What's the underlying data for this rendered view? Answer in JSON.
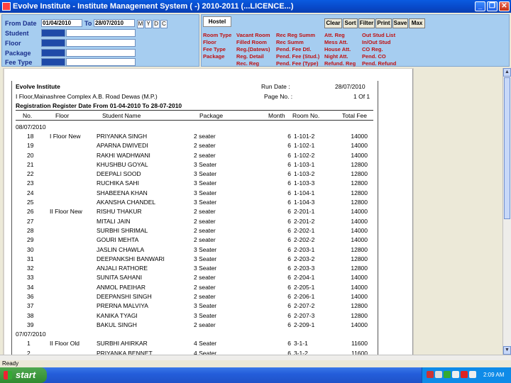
{
  "window": {
    "title": "Evolve Institute - Institute Management System ( -) 2010-2011 (...LICENCE...)",
    "minimize_icon": "minimize-icon",
    "restore_icon": "restore-icon",
    "close_icon": "close-icon"
  },
  "filters": {
    "from_label": "From Date",
    "from_value": "01/04/2010",
    "to_label": "To",
    "to_value": "28/07/2010",
    "period_buttons": [
      "M",
      "Y",
      "D",
      "C"
    ],
    "student_label": "Student",
    "floor_label": "Floor",
    "package_label": "Package",
    "feetype_label": "Fee Type"
  },
  "hostel": {
    "tab_label": "Hostel",
    "toolbar": [
      "Clear",
      "Sort",
      "Filter",
      "Print",
      "Save",
      "Max"
    ],
    "links": {
      "col1": [
        "Room Type",
        "Floor",
        "Fee Type",
        "Package"
      ],
      "col2": [
        "Vacant Room",
        "Filled Room",
        "Reg.(Datews)",
        "Reg. Detail",
        "Rec. Reg"
      ],
      "col3": [
        "Rec Reg Summ",
        "Rec Summ",
        "Pend. Fee Dtl.",
        "Pend. Fee (Stud.)",
        "Pend. Fee (Type)"
      ],
      "col4": [
        "Att. Reg",
        "Mess Att.",
        "House Att.",
        "Night Att.",
        "Refund. Reg"
      ],
      "col5": [
        "Out Stud List",
        "In/Out Stud",
        "CO Reg.",
        "Pend. CO",
        "Pend. Refund"
      ]
    }
  },
  "report": {
    "institute": "Evolve Institute",
    "address": "I Floor,Mainashree Complex A.B. Road Dewas (M.P.)",
    "title": "Registration Register Date From 01-04-2010 To 28-07-2010",
    "run_date_label": "Run Date :",
    "run_date": "28/07/2010",
    "page_no_label": "Page No. :",
    "page_no": "1 Of 1",
    "columns": [
      "No.",
      "Floor",
      "Student Name",
      "Package",
      "Month",
      "Room No.",
      "Total Fee"
    ],
    "rows": [
      {
        "no": "08/07/2010",
        "floor": "",
        "name": "",
        "pkg": "",
        "month": "",
        "room": "",
        "fee": ""
      },
      {
        "no": "18",
        "floor": "I Floor New",
        "name": "PRIYANKA SINGH",
        "pkg": "2 seater",
        "month": "6",
        "room": "1-101-2",
        "fee": "14000"
      },
      {
        "no": "19",
        "floor": "",
        "name": "APARNA DWIVEDI",
        "pkg": "2 seater",
        "month": "6",
        "room": "1-102-1",
        "fee": "14000"
      },
      {
        "no": "20",
        "floor": "",
        "name": "RAKHI WADHWANI",
        "pkg": "2 seater",
        "month": "6",
        "room": "1-102-2",
        "fee": "14000"
      },
      {
        "no": "21",
        "floor": "",
        "name": "KHUSHBU GOYAL",
        "pkg": "3 Seater",
        "month": "6",
        "room": "1-103-1",
        "fee": "12800"
      },
      {
        "no": "22",
        "floor": "",
        "name": "DEEPALI SOOD",
        "pkg": "3 Seater",
        "month": "6",
        "room": "1-103-2",
        "fee": "12800"
      },
      {
        "no": "23",
        "floor": "",
        "name": "RUCHIKA SAHI",
        "pkg": "3 Seater",
        "month": "6",
        "room": "1-103-3",
        "fee": "12800"
      },
      {
        "no": "24",
        "floor": "",
        "name": "SHABEENA KHAN",
        "pkg": "3 Seater",
        "month": "6",
        "room": "1-104-1",
        "fee": "12800"
      },
      {
        "no": "25",
        "floor": "",
        "name": "AKANSHA CHANDEL",
        "pkg": "3 Seater",
        "month": "6",
        "room": "1-104-3",
        "fee": "12800"
      },
      {
        "no": "26",
        "floor": "II Floor New",
        "name": "RISHU THAKUR",
        "pkg": "2 seater",
        "month": "6",
        "room": "2-201-1",
        "fee": "14000"
      },
      {
        "no": "27",
        "floor": "",
        "name": "MITALI JAIN",
        "pkg": "2 seater",
        "month": "6",
        "room": "2-201-2",
        "fee": "14000"
      },
      {
        "no": "28",
        "floor": "",
        "name": "SURBHI SHRIMAL",
        "pkg": "2 seater",
        "month": "6",
        "room": "2-202-1",
        "fee": "14000"
      },
      {
        "no": "29",
        "floor": "",
        "name": "GOURI MEHTA",
        "pkg": "2 seater",
        "month": "6",
        "room": "2-202-2",
        "fee": "14000"
      },
      {
        "no": "30",
        "floor": "",
        "name": "JASLIN CHAWLA",
        "pkg": "3 Seater",
        "month": "6",
        "room": "2-203-1",
        "fee": "12800"
      },
      {
        "no": "31",
        "floor": "",
        "name": "DEEPANKSHI BANWARI",
        "pkg": "3 Seater",
        "month": "6",
        "room": "2-203-2",
        "fee": "12800"
      },
      {
        "no": "32",
        "floor": "",
        "name": "ANJALI RATHORE",
        "pkg": "3 Seater",
        "month": "6",
        "room": "2-203-3",
        "fee": "12800"
      },
      {
        "no": "33",
        "floor": "",
        "name": "SUNITA SAHANI",
        "pkg": "2 seater",
        "month": "6",
        "room": "2-204-1",
        "fee": "14000"
      },
      {
        "no": "34",
        "floor": "",
        "name": "ANMOL PAEIHAR",
        "pkg": "2 seater",
        "month": "6",
        "room": "2-205-1",
        "fee": "14000"
      },
      {
        "no": "36",
        "floor": "",
        "name": "DEEPANSHI SINGH",
        "pkg": "2 seater",
        "month": "6",
        "room": "2-206-1",
        "fee": "14000"
      },
      {
        "no": "37",
        "floor": "",
        "name": "PRERNA MALVIYA",
        "pkg": "3 Seater",
        "month": "6",
        "room": "2-207-2",
        "fee": "12800"
      },
      {
        "no": "38",
        "floor": "",
        "name": "KANIKA TYAGI",
        "pkg": "3 Seater",
        "month": "6",
        "room": "2-207-3",
        "fee": "12800"
      },
      {
        "no": "39",
        "floor": "",
        "name": "BAKUL SINGH",
        "pkg": "2 seater",
        "month": "6",
        "room": "2-209-1",
        "fee": "14000"
      },
      {
        "no": "07/07/2010",
        "floor": "",
        "name": "",
        "pkg": "",
        "month": "",
        "room": "",
        "fee": ""
      },
      {
        "no": "1",
        "floor": "II Floor Old",
        "name": "SURBHI AHIRKAR",
        "pkg": "4 Seater",
        "month": "6",
        "room": "3-1-1",
        "fee": "11600"
      },
      {
        "no": "2",
        "floor": "",
        "name": "PRIYANKA BENNET",
        "pkg": "4 Seater",
        "month": "6",
        "room": "3-1-2",
        "fee": "11600"
      }
    ]
  },
  "statusbar": {
    "text": "Ready"
  },
  "taskbar": {
    "start_label": "start",
    "clock": "2:09 AM"
  }
}
